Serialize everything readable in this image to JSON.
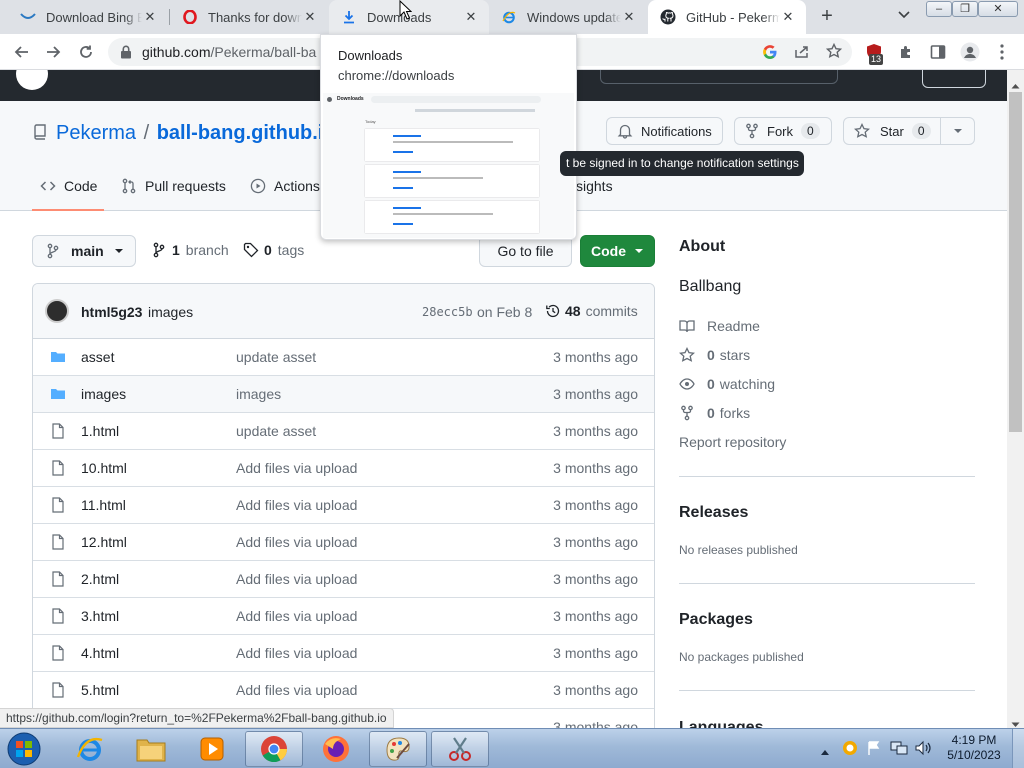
{
  "browser": {
    "tabs": [
      {
        "title": "Download Bing Browser",
        "icon": "bing-icon",
        "close": "✕"
      },
      {
        "title": "Thanks for downloading",
        "icon": "opera-icon",
        "close": "✕"
      },
      {
        "title": "Downloads",
        "icon": "download-icon",
        "close": "✕"
      },
      {
        "title": "Windows update",
        "icon": "ie-icon",
        "close": "✕"
      },
      {
        "title": "GitHub - Pekerma",
        "icon": "github-icon",
        "close": "✕"
      }
    ],
    "new_tab": "+",
    "url_host": "github.com",
    "url_path": "/Pekerma/ball-ba",
    "extension_badge": "13",
    "window_buttons": {
      "minimize": "–",
      "restore": "❐",
      "close": "✕"
    }
  },
  "downloads_popup": {
    "title": "Downloads",
    "url": "chrome://downloads",
    "thumb_header": "Downloads",
    "thumb_today": "Today"
  },
  "repo": {
    "owner": "Pekerma",
    "separator": "/",
    "name": "ball-bang.github.io",
    "notifications_label": "Notifications",
    "fork_label": "Fork",
    "fork_count": "0",
    "star_label": "Star",
    "star_count": "0",
    "tooltip": "t be signed in to change notification settings",
    "nav": {
      "code": "Code",
      "pulls": "Pull requests",
      "actions": "Actions",
      "insights": "sights"
    }
  },
  "toolbar": {
    "branch": "main",
    "branch_count": "1",
    "branch_word": "branch",
    "tag_count": "0",
    "tag_word": "tags",
    "goto_file": "Go to file",
    "code_button": "Code"
  },
  "commit": {
    "author": "html5g23",
    "message": "images",
    "sha": "28ecc5b",
    "date": "on Feb 8",
    "count": "48",
    "count_word": "commits"
  },
  "files": [
    {
      "name": "asset",
      "type": "dir",
      "message": "update asset",
      "date": "3 months ago"
    },
    {
      "name": "images",
      "type": "dir",
      "message": "images",
      "date": "3 months ago"
    },
    {
      "name": "1.html",
      "type": "file",
      "message": "update asset",
      "date": "3 months ago"
    },
    {
      "name": "10.html",
      "type": "file",
      "message": "Add files via upload",
      "date": "3 months ago"
    },
    {
      "name": "11.html",
      "type": "file",
      "message": "Add files via upload",
      "date": "3 months ago"
    },
    {
      "name": "12.html",
      "type": "file",
      "message": "Add files via upload",
      "date": "3 months ago"
    },
    {
      "name": "2.html",
      "type": "file",
      "message": "Add files via upload",
      "date": "3 months ago"
    },
    {
      "name": "3.html",
      "type": "file",
      "message": "Add files via upload",
      "date": "3 months ago"
    },
    {
      "name": "4.html",
      "type": "file",
      "message": "Add files via upload",
      "date": "3 months ago"
    },
    {
      "name": "5.html",
      "type": "file",
      "message": "Add files via upload",
      "date": "3 months ago"
    },
    {
      "name": "",
      "type": "file",
      "message": "",
      "date": "3 months ago"
    }
  ],
  "about": {
    "title": "About",
    "description": "Ballbang",
    "readme": "Readme",
    "stars_count": "0",
    "stars_word": "stars",
    "watching_count": "0",
    "watching_word": "watching",
    "forks_count": "0",
    "forks_word": "forks",
    "report": "Report repository"
  },
  "releases": {
    "title": "Releases",
    "text": "No releases published"
  },
  "packages": {
    "title": "Packages",
    "text": "No packages published"
  },
  "languages": {
    "title": "Languages"
  },
  "status_url": "https://github.com/login?return_to=%2FPekerma%2Fball-bang.github.io",
  "taskbar": {
    "time": "4:19 PM",
    "date": "5/10/2023",
    "apps": [
      "start-orb-icon",
      "internet-explorer-icon",
      "file-explorer-icon",
      "media-player-icon",
      "chrome-icon",
      "firefox-icon",
      "paint-icon",
      "snipping-tool-icon"
    ]
  },
  "colors": {
    "github_dark": "#24292f",
    "link_blue": "#0969da",
    "green_button": "#1f883d",
    "folder_blue": "#54aeff"
  }
}
